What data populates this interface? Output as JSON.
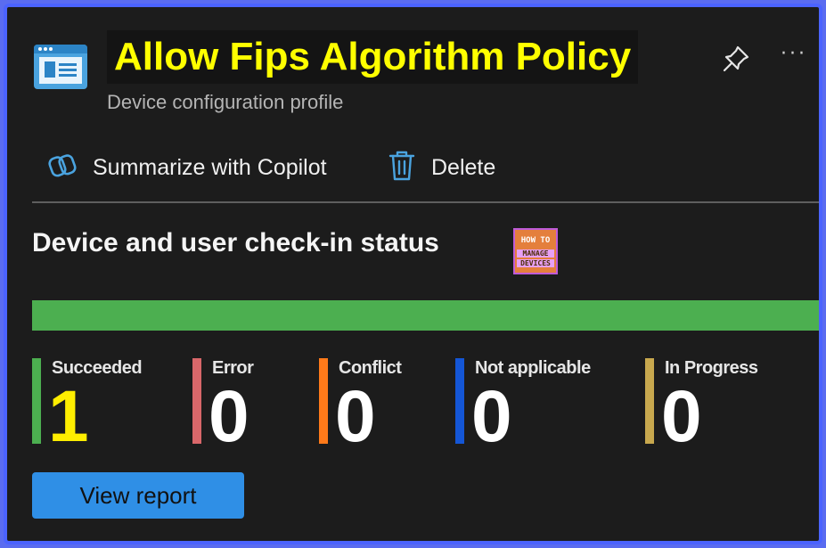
{
  "header": {
    "title": "Allow Fips Algorithm Policy",
    "subtitle": "Device configuration profile",
    "icon": "device-configuration-icon"
  },
  "toolbar": {
    "copilot_label": "Summarize with Copilot",
    "delete_label": "Delete",
    "icons": [
      "copilot-icon",
      "trash-icon",
      "pin-icon",
      "ellipsis-icon"
    ],
    "more_glyph": "···"
  },
  "section": {
    "title": "Device and user check-in status",
    "logo_line1": "HOW TO",
    "logo_line2": "MANAGE",
    "logo_line3": "DEVICES"
  },
  "progress": {
    "succeeded_fraction": 1.0,
    "color": "#4caf50"
  },
  "stats": [
    {
      "label": "Succeeded",
      "value": "1",
      "color": "#4caf50",
      "value_color": "#ffee00"
    },
    {
      "label": "Error",
      "value": "0",
      "color": "#d9676a",
      "value_color": "#ffffff"
    },
    {
      "label": "Conflict",
      "value": "0",
      "color": "#ff7a1a",
      "value_color": "#ffffff"
    },
    {
      "label": "Not applicable",
      "value": "0",
      "color": "#1456d6",
      "value_color": "#ffffff"
    },
    {
      "label": "In Progress",
      "value": "0",
      "color": "#c8a84e",
      "value_color": "#ffffff"
    }
  ],
  "actions": {
    "view_report_label": "View report"
  },
  "colors": {
    "accent": "#2f8fe6",
    "title_highlight": "#ffff00",
    "frame": "#4b63ff"
  }
}
